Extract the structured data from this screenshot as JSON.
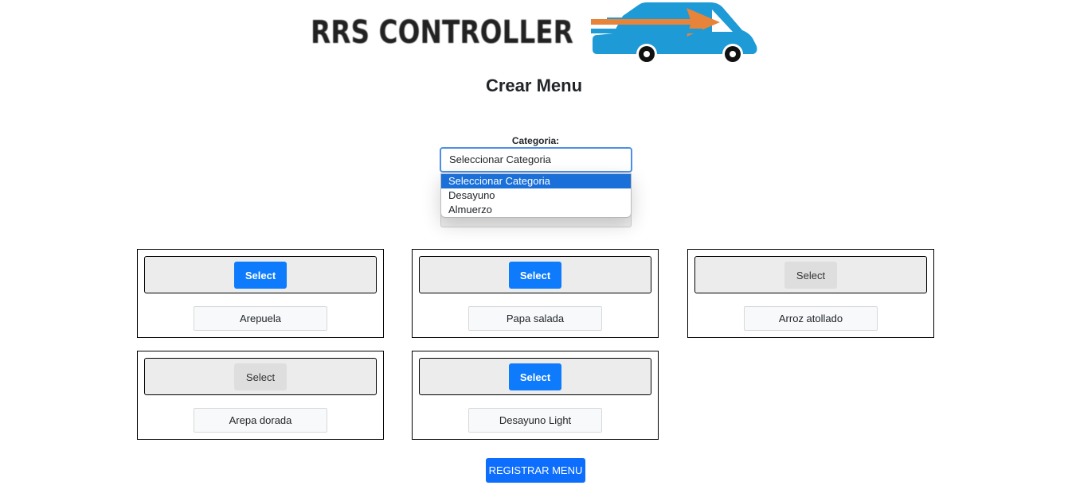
{
  "logo": {
    "text": "RRS CONTROLLER",
    "icon": "truck-arrow-icon",
    "colors": {
      "truck": "#1e9ad6",
      "arrow": "#e8843a",
      "wheels": "#111111"
    }
  },
  "page_title": "Crear Menu",
  "category": {
    "label": "Categoria:",
    "selected": "Seleccionar Categoria",
    "options": [
      {
        "label": "Seleccionar Categoria",
        "highlighted": true
      },
      {
        "label": "Desayuno",
        "highlighted": false
      },
      {
        "label": "Almuerzo",
        "highlighted": false
      }
    ]
  },
  "cards": [
    {
      "name": "Arepuela",
      "select_label": "Select",
      "active": true
    },
    {
      "name": "Papa salada",
      "select_label": "Select",
      "active": true
    },
    {
      "name": "Arroz atollado",
      "select_label": "Select",
      "active": false
    },
    {
      "name": "Arepa dorada",
      "select_label": "Select",
      "active": false
    },
    {
      "name": "Desayuno Light",
      "select_label": "Select",
      "active": true
    }
  ],
  "register_button": "REGISTRAR MENU",
  "colors": {
    "primary": "#0d6efd",
    "select_active": "#0d7bfb",
    "select_inactive": "#dedede",
    "option_highlight": "#1a6fd8",
    "focus_border": "#4d8fe6"
  }
}
